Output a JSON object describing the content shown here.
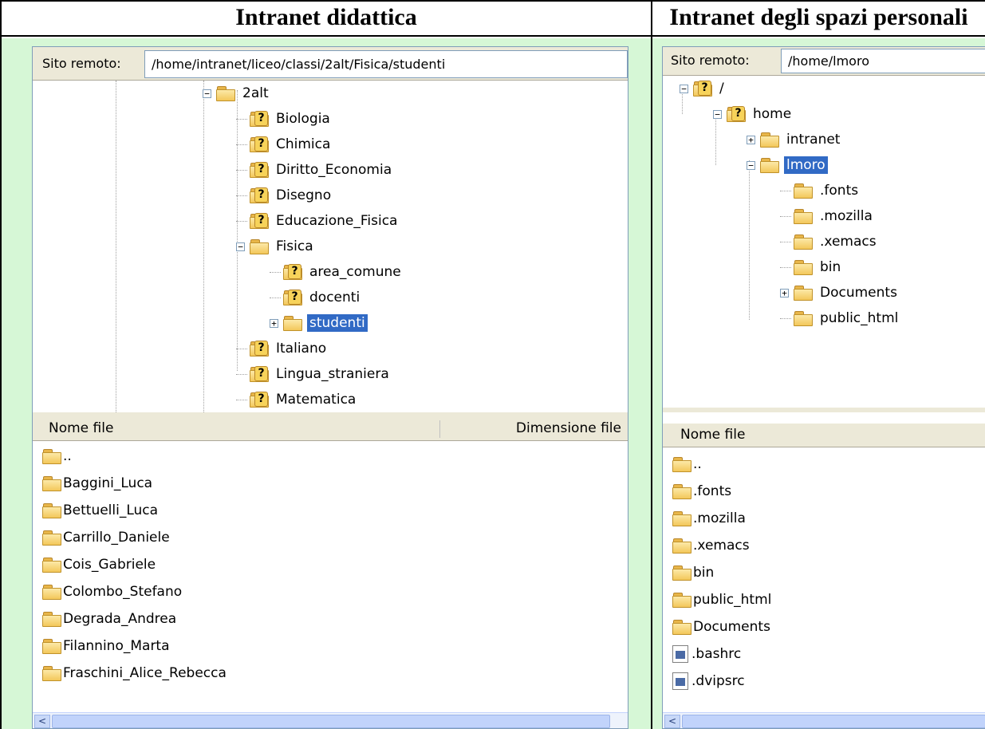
{
  "left": {
    "title": "Intranet didattica",
    "remote_label": "Sito remoto:",
    "remote_path": "/home/intranet/liceo/classi/2alt/Fisica/studenti",
    "tree": [
      {
        "label": "2alt",
        "level": 0,
        "expander": "minus",
        "icon": "folder"
      },
      {
        "label": "Biologia",
        "level": 1,
        "expander": "",
        "icon": "qfolder"
      },
      {
        "label": "Chimica",
        "level": 1,
        "expander": "",
        "icon": "qfolder"
      },
      {
        "label": "Diritto_Economia",
        "level": 1,
        "expander": "",
        "icon": "qfolder"
      },
      {
        "label": "Disegno",
        "level": 1,
        "expander": "",
        "icon": "qfolder"
      },
      {
        "label": "Educazione_Fisica",
        "level": 1,
        "expander": "",
        "icon": "qfolder"
      },
      {
        "label": "Fisica",
        "level": 1,
        "expander": "minus",
        "icon": "folder"
      },
      {
        "label": "area_comune",
        "level": 2,
        "expander": "",
        "icon": "qfolder"
      },
      {
        "label": "docenti",
        "level": 2,
        "expander": "",
        "icon": "qfolder"
      },
      {
        "label": "studenti",
        "level": 2,
        "expander": "plus",
        "icon": "folder",
        "selected": true
      },
      {
        "label": "Italiano",
        "level": 1,
        "expander": "",
        "icon": "qfolder"
      },
      {
        "label": "Lingua_straniera",
        "level": 1,
        "expander": "",
        "icon": "qfolder"
      },
      {
        "label": "Matematica",
        "level": 1,
        "expander": "",
        "icon": "qfolder"
      }
    ],
    "col_name": "Nome file",
    "col_size": "Dimensione file",
    "files": [
      {
        "name": "..",
        "icon": "folder"
      },
      {
        "name": "Baggini_Luca",
        "icon": "folder"
      },
      {
        "name": "Bettuelli_Luca",
        "icon": "folder"
      },
      {
        "name": "Carrillo_Daniele",
        "icon": "folder"
      },
      {
        "name": "Cois_Gabriele",
        "icon": "folder"
      },
      {
        "name": "Colombo_Stefano",
        "icon": "folder"
      },
      {
        "name": "Degrada_Andrea",
        "icon": "folder"
      },
      {
        "name": "Filannino_Marta",
        "icon": "folder"
      },
      {
        "name": "Fraschini_Alice_Rebecca",
        "icon": "folder"
      }
    ]
  },
  "right": {
    "title": "Intranet degli spazi personali",
    "remote_label": "Sito remoto:",
    "remote_path": "/home/lmoro",
    "tree": [
      {
        "label": "/",
        "level": 0,
        "expander": "minus",
        "icon": "qfolder"
      },
      {
        "label": "home",
        "level": 1,
        "expander": "minus",
        "icon": "qfolder"
      },
      {
        "label": "intranet",
        "level": 2,
        "expander": "plus",
        "icon": "folder"
      },
      {
        "label": "lmoro",
        "level": 2,
        "expander": "minus",
        "icon": "folder",
        "selected": true
      },
      {
        "label": ".fonts",
        "level": 3,
        "expander": "",
        "icon": "folder"
      },
      {
        "label": ".mozilla",
        "level": 3,
        "expander": "",
        "icon": "folder"
      },
      {
        "label": ".xemacs",
        "level": 3,
        "expander": "",
        "icon": "folder"
      },
      {
        "label": "bin",
        "level": 3,
        "expander": "",
        "icon": "folder"
      },
      {
        "label": "Documents",
        "level": 3,
        "expander": "plus",
        "icon": "folder"
      },
      {
        "label": "public_html",
        "level": 3,
        "expander": "",
        "icon": "folder"
      }
    ],
    "col_name": "Nome file",
    "files": [
      {
        "name": "..",
        "icon": "folder"
      },
      {
        "name": ".fonts",
        "icon": "folder"
      },
      {
        "name": ".mozilla",
        "icon": "folder"
      },
      {
        "name": ".xemacs",
        "icon": "folder"
      },
      {
        "name": "bin",
        "icon": "folder"
      },
      {
        "name": "public_html",
        "icon": "folder"
      },
      {
        "name": "Documents",
        "icon": "folder"
      },
      {
        "name": ".bashrc",
        "icon": "file"
      },
      {
        "name": ".dvipsrc",
        "icon": "file"
      }
    ]
  },
  "colors": {
    "background_green": "#d6f7d6",
    "selection": "#316ac5",
    "toolbar": "#ece9d8"
  }
}
